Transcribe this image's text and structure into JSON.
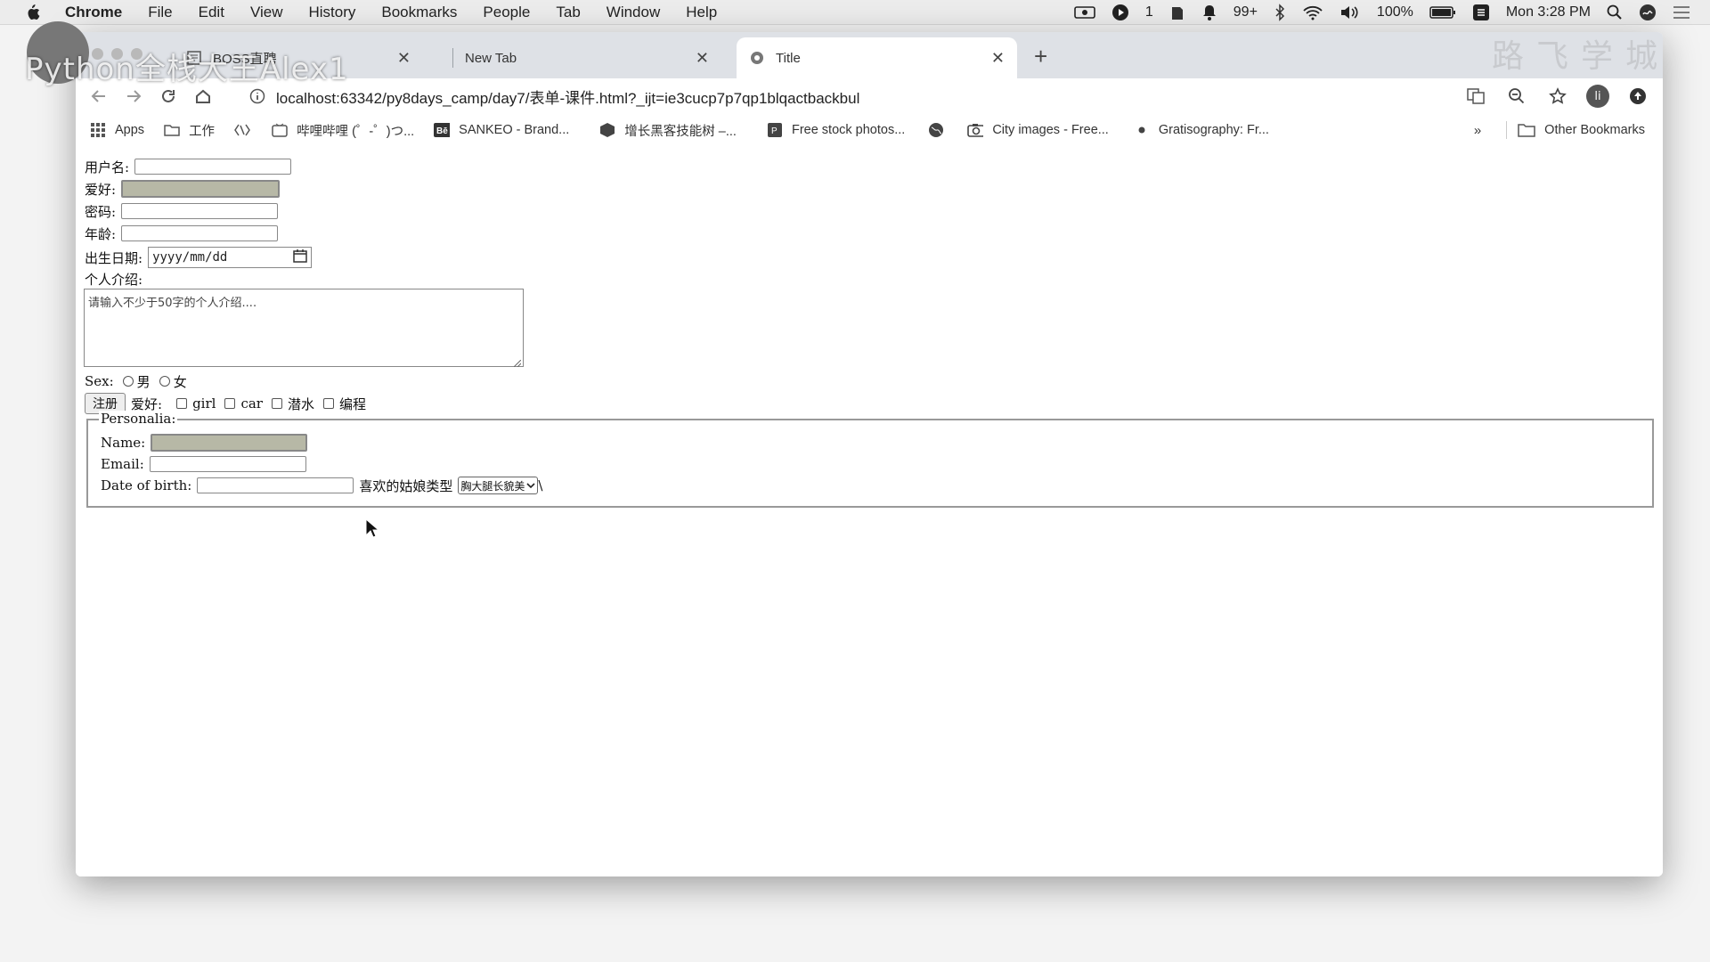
{
  "menubar": {
    "app": "Chrome",
    "items": [
      "File",
      "Edit",
      "View",
      "History",
      "Bookmarks",
      "People",
      "Tab",
      "Window",
      "Help"
    ],
    "status": {
      "notif_count": "1",
      "badge": "99+",
      "battery": "100%",
      "clock": "Mon 3:28 PM"
    }
  },
  "watermark": {
    "left": "Python全栈大王Alex1",
    "right": "路飞学城"
  },
  "tabs": [
    {
      "title": "BOSS直聘"
    },
    {
      "title": "New Tab"
    },
    {
      "title": "Title"
    }
  ],
  "toolbar": {
    "url": "localhost:63342/py8days_camp/day7/表单-课件.html?_ijt=ie3cucp7p7qp1blqactbackbul",
    "profile_initial": "li"
  },
  "bookmarks": {
    "items": [
      {
        "label": "Apps",
        "icon": "apps-grid-icon"
      },
      {
        "label": "工作",
        "icon": "folder-icon"
      },
      {
        "label": "",
        "icon": "bracket-icon"
      },
      {
        "label": "哔哩哔哩 (゜-゜)つ...",
        "icon": "bilibili-icon"
      },
      {
        "label": "SANKEO - Brand...",
        "icon": "behance-icon"
      },
      {
        "label": "增长黑客技能树 –...",
        "icon": "cube-icon"
      },
      {
        "label": "Free stock photos...",
        "icon": "pexels-icon"
      },
      {
        "label": "",
        "icon": "globe-icon"
      },
      {
        "label": "City images - Free...",
        "icon": "camera-icon"
      },
      {
        "label": "Gratisography: Fr...",
        "icon": "dot-icon"
      }
    ],
    "overflow": "»",
    "other": "Other Bookmarks"
  },
  "form": {
    "username_label": "用户名:",
    "hobby_label": "爱好:",
    "password_label": "密码:",
    "age_label": "年龄:",
    "birthday_label": "出生日期:",
    "birthday_placeholder": "yyyy/mm/dd",
    "intro_label": "个人介绍:",
    "intro_placeholder": "请输入不少于50字的个人介绍....",
    "sex_label": "Sex:",
    "sex_options": [
      "男",
      "女"
    ],
    "register_button": "注册",
    "hobbies_label": "爱好:",
    "hobby_options": [
      "girl",
      "car",
      "潜水",
      "编程"
    ]
  },
  "fieldset": {
    "legend": "Personalia:",
    "name_label": "Name:",
    "email_label": "Email:",
    "dob_label": "Date of birth:",
    "girl_type_label": "喜欢的姑娘类型",
    "girl_type_selected": "胸大腿长貌美",
    "trailing": "\\"
  }
}
